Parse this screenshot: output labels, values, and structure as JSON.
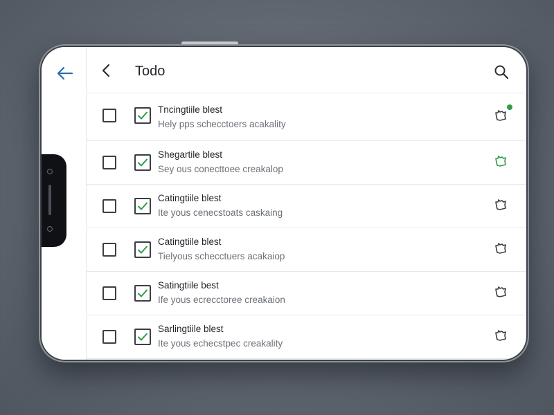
{
  "header": {
    "title": "Todo"
  },
  "icons": {
    "rail_back": "arrow-left-icon",
    "back": "chevron-left-icon",
    "search": "search-icon"
  },
  "colors": {
    "accent": "#2b6cb0",
    "check_green": "#2e9d4a",
    "text_primary": "#1f2328",
    "text_secondary": "#6b7178"
  },
  "tasks": [
    {
      "title": "Tncingtiile blest",
      "subtitle": "Hely pps schecctoers acakality",
      "checked": true,
      "trail_icon": "hand-icon",
      "trail_color": "#3a3f45",
      "badge": true
    },
    {
      "title": "Shegartile blest",
      "subtitle": "Sey ous conecttoee creakalop",
      "checked": true,
      "trail_icon": "hand-icon",
      "trail_color": "#2e9d4a",
      "badge": false
    },
    {
      "title": "Catingtiile blest",
      "subtitle": "Ite yous cenecstoats caskaing",
      "checked": true,
      "trail_icon": "hand-icon",
      "trail_color": "#3a3f45",
      "badge": false
    },
    {
      "title": "Catingtiile blest",
      "subtitle": "Tielyous schecctuers acakaiop",
      "checked": true,
      "trail_icon": "hand-icon",
      "trail_color": "#3a3f45",
      "badge": false
    },
    {
      "title": "Satingtiile best",
      "subtitle": "Ife yous ecrecctoree creakaion",
      "checked": true,
      "trail_icon": "hand-icon",
      "trail_color": "#3a3f45",
      "badge": false
    },
    {
      "title": "Sarlingtiile blest",
      "subtitle": "Ite yous echecstpec creakality",
      "checked": true,
      "trail_icon": "hand-icon",
      "trail_color": "#3a3f45",
      "badge": false
    }
  ]
}
